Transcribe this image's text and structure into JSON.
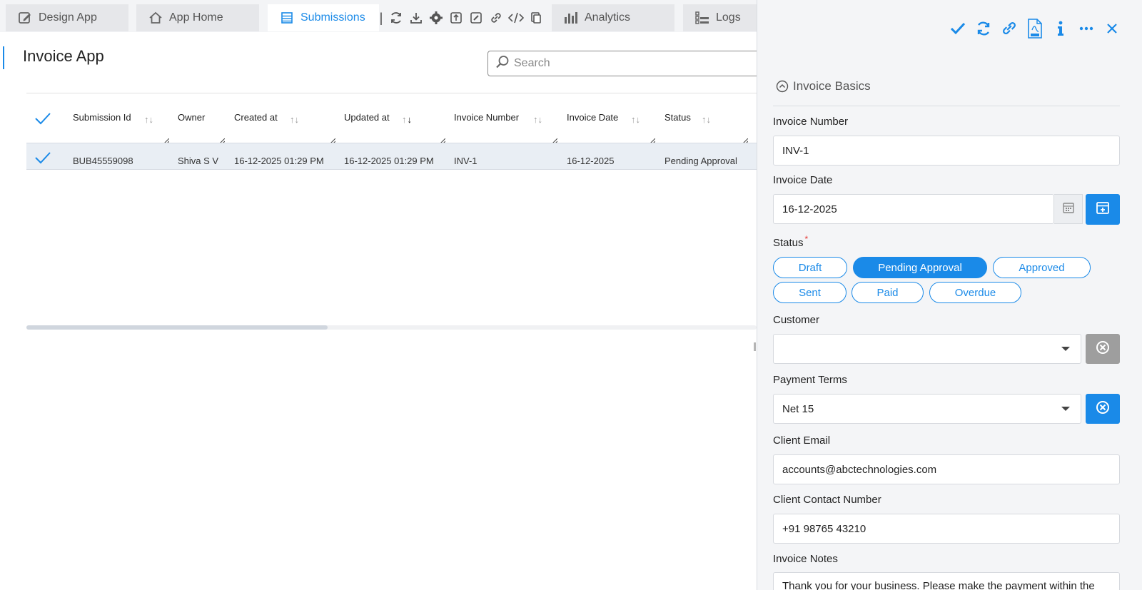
{
  "tabs": {
    "design_app": "Design App",
    "app_home": "App Home",
    "submissions": "Submissions",
    "analytics": "Analytics",
    "logs": "Logs",
    "separator": "|"
  },
  "main": {
    "title": "Invoice App",
    "search_placeholder": "Search"
  },
  "table": {
    "columns": [
      "Submission Id",
      "Owner",
      "Created at",
      "Updated at",
      "Invoice Number",
      "Invoice Date",
      "Status"
    ],
    "rows": [
      [
        "BUB45559098",
        "Shiva S V",
        "16-12-2025 01:29 PM",
        "16-12-2025 01:29 PM",
        "INV-1",
        "16-12-2025",
        "Pending Approval"
      ]
    ]
  },
  "panel": {
    "section_title": "Invoice Basics",
    "invoice_number_label": "Invoice Number",
    "invoice_number_value": "INV-1",
    "invoice_date_label": "Invoice Date",
    "invoice_date_value": "16-12-2025",
    "status_label": "Status",
    "status_required": "*",
    "status_options": [
      "Draft",
      "Pending Approval",
      "Approved",
      "Sent",
      "Paid",
      "Overdue"
    ],
    "status_selected": "Pending Approval",
    "customer_label": "Customer",
    "customer_value": "",
    "payment_terms_label": "Payment Terms",
    "payment_terms_value": "Net 15",
    "client_email_label": "Client Email",
    "client_email_value": "accounts@abctechnologies.com",
    "client_contact_label": "Client Contact Number",
    "client_contact_value": "+91 98765 43210",
    "invoice_notes_label": "Invoice Notes",
    "invoice_notes_value": "Thank you for your business. Please make the payment within the"
  },
  "colors": {
    "accent": "#1a8ae8",
    "selected_row": "#e9eef4",
    "clear_disabled": "#9e9e9e"
  }
}
